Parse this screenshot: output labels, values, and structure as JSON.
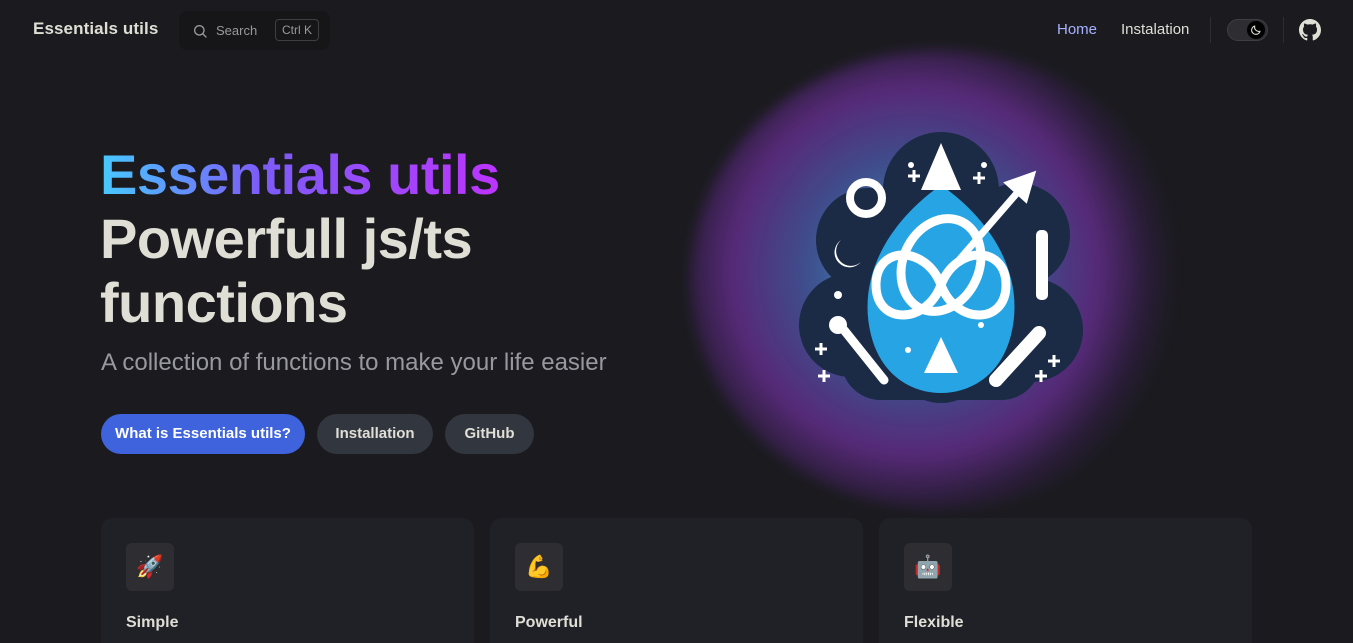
{
  "nav": {
    "brand": "Essentials utils",
    "search": {
      "label": "Search",
      "shortcut": "Ctrl K"
    },
    "links": [
      {
        "label": "Home",
        "active": true
      },
      {
        "label": "Instalation",
        "active": false
      }
    ],
    "theme_toggle": "moon-icon",
    "social": "github-icon"
  },
  "hero": {
    "name": "Essentials utils",
    "text": "Powerfull js/ts functions",
    "tagline": "A collection of functions to make your life easier",
    "actions": [
      {
        "label": "What is Essentials utils?",
        "theme": "brand"
      },
      {
        "label": "Installation",
        "theme": "alt"
      },
      {
        "label": "GitHub",
        "theme": "alt"
      }
    ]
  },
  "features": [
    {
      "icon": "🚀",
      "title": "Simple"
    },
    {
      "icon": "💪",
      "title": "Powerful"
    },
    {
      "icon": "🤖",
      "title": "Flexible"
    }
  ],
  "colors": {
    "background": "#1b1b1f",
    "brand": "#3e63dd",
    "active_link": "#a8b1ff",
    "gradient": [
      "#47caff",
      "#bd34fe"
    ]
  }
}
